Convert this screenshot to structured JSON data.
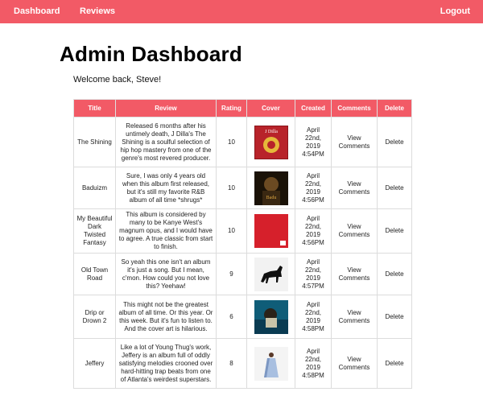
{
  "nav": {
    "dashboard": "Dashboard",
    "reviews": "Reviews",
    "logout": "Logout"
  },
  "page": {
    "title": "Admin Dashboard",
    "welcome": "Welcome back, Steve!"
  },
  "table": {
    "headers": {
      "title": "Title",
      "review": "Review",
      "rating": "Rating",
      "cover": "Cover",
      "created": "Created",
      "comments": "Comments",
      "delete": "Delete"
    },
    "rows": [
      {
        "title": "The Shining",
        "review": "Released 6 months after his untimely death, J Dilla's The Shining is a soulful selection of hip hop mastery from one of the genre's most revered producer.",
        "rating": "10",
        "cover_icon": "album-cover-the-shining",
        "created": "April 22nd, 2019 4:54PM",
        "comments": "View Comments",
        "delete": "Delete"
      },
      {
        "title": "Baduizm",
        "review": "Sure, I was only 4 years old when this album first released, but it's still my favorite R&B album of all time *shrugs*",
        "rating": "10",
        "cover_icon": "album-cover-baduizm",
        "created": "April 22nd, 2019 4:56PM",
        "comments": "View Comments",
        "delete": "Delete"
      },
      {
        "title": "My Beautiful Dark Twisted Fantasy",
        "review": "This album is considered by many to be Kanye West's magnum opus, and I would have to agree. A true classic from start to finish.",
        "rating": "10",
        "cover_icon": "album-cover-mbdtf",
        "created": "April 22nd, 2019 4:56PM",
        "comments": "View Comments",
        "delete": "Delete"
      },
      {
        "title": "Old Town Road",
        "review": "So yeah this one isn't an album it's just a song. But I mean, c'mon. How could you not love this? Yeehaw!",
        "rating": "9",
        "cover_icon": "album-cover-old-town-road",
        "created": "April 22nd, 2019 4:57PM",
        "comments": "View Comments",
        "delete": "Delete"
      },
      {
        "title": "Drip or Drown 2",
        "review": "This might not be the greatest album of all time. Or this year. Or this week. But it's fun to listen to. And the cover art is hilarious.",
        "rating": "6",
        "cover_icon": "album-cover-drip-or-drown-2",
        "created": "April 22nd, 2019 4:58PM",
        "comments": "View Comments",
        "delete": "Delete"
      },
      {
        "title": "Jeffery",
        "review": "Like a lot of Young Thug's work, Jeffery is an album full of oddly satisfying melodies crooned over hard-hitting trap beats from one of Atlanta's weirdest superstars.",
        "rating": "8",
        "cover_icon": "album-cover-jeffery",
        "created": "April 22nd, 2019 4:58PM",
        "comments": "View Comments",
        "delete": "Delete"
      }
    ]
  },
  "colors": {
    "accent": "#f25a66",
    "link": "#e8505d"
  }
}
